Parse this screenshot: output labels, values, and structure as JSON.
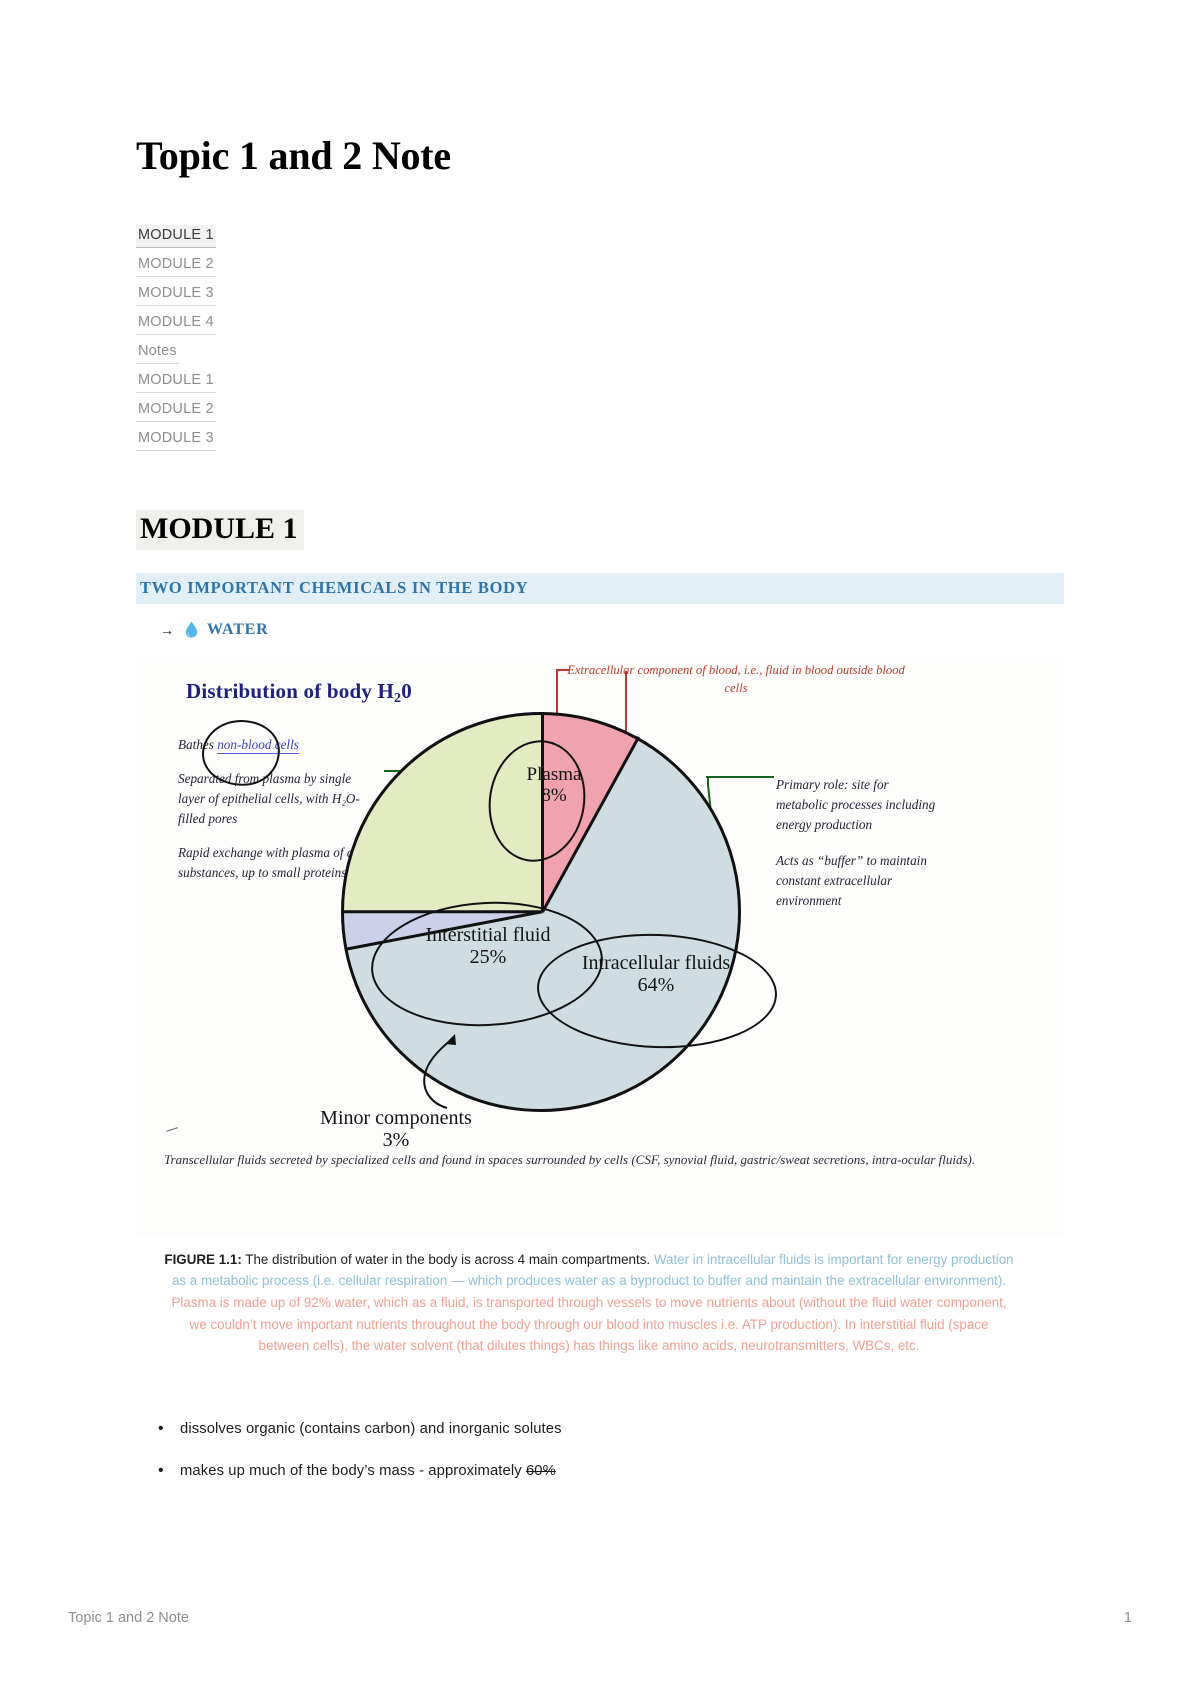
{
  "document": {
    "title": "Topic 1 and 2 Note",
    "footer_left": "Topic 1 and 2 Note",
    "footer_right": "1"
  },
  "toc": {
    "items": [
      {
        "label": "MODULE 1",
        "active": true
      },
      {
        "label": "MODULE 2",
        "active": false
      },
      {
        "label": "MODULE 3",
        "active": false
      },
      {
        "label": "MODULE 4",
        "active": false
      },
      {
        "label": "Notes",
        "active": false
      },
      {
        "label": "MODULE 1",
        "active": false
      },
      {
        "label": "MODULE 2",
        "active": false
      },
      {
        "label": "MODULE 3",
        "active": false
      }
    ]
  },
  "headings": {
    "module": "MODULE 1",
    "section": "TWO IMPORTANT CHEMICALS IN THE BODY",
    "module_highlight_color": "#efefec",
    "section_highlight_color": "#e3eff6",
    "section_text_color": "#2e74a8"
  },
  "water_item": {
    "arrow": "→",
    "icon": "water-droplet-icon",
    "label": "WATER",
    "color": "#2e74a8"
  },
  "figure": {
    "title_main": "Distribution of body H",
    "title_sub": "2",
    "title_tail": "0",
    "title_color": "#202080",
    "annotations": {
      "left_1_prefix": "Bathes ",
      "left_1_underlined": "non-blood cells",
      "left_2": "Separated from plasma by single layer of epithelial cells, with H₂O-filled pores",
      "left_3": "Rapid exchange with plasma of all substances, up to small proteins.",
      "top_right_red": "Extracellular component of blood, i.e., fluid in blood outside blood cells",
      "right_1": "Primary role: site for metabolic processes including energy production",
      "right_2": "Acts as “buffer” to maintain constant extracellular environment"
    },
    "footnote": "Transcellular fluids secreted by specialized cells and found in spaces surrounded by cells (CSF, synovial fluid, gastric/sweat secretions, intra-ocular fluids).",
    "caption": {
      "lead": "FIGURE 1.1:",
      "black_text": " The distribution of water in the body is across 4 main compartments. ",
      "blue_text": "Water in intracellular fluids is important for energy production as a metabolic process (i.e. cellular respiration — which produces water as a byproduct to buffer and maintain the extracellular environment). ",
      "salmon_text": "Plasma is made up of 92% water, which as a fluid, is transported through vessels to move nutrients about (without the fluid water component, we couldn’t move important nutrients throughout the body through our blood into muscles i.e. ATP production). In interstitial fluid (space between cells), the water solvent (that dilutes things) has things like amino acids, neurotransmitters, WBCs, etc.",
      "black_color": "#1f1f1f",
      "blue_color": "#8fc0d6",
      "salmon_color": "#ef9f92"
    }
  },
  "chart_data": {
    "type": "pie",
    "title": "Distribution of body H20",
    "categories": [
      "Plasma",
      "Intracellular fluids",
      "Minor components",
      "Interstitial fluid"
    ],
    "values": [
      8,
      64,
      3,
      25
    ],
    "labels": [
      {
        "name": "Plasma",
        "percent": "8%",
        "color": "#f0a3ae"
      },
      {
        "name": "Intracellular fluids",
        "percent": "64%",
        "color": "#cfdde2"
      },
      {
        "name": "Minor components",
        "percent": "3%",
        "color": "#ccd0ea"
      },
      {
        "name": "Interstitial fluid",
        "percent": "25%",
        "color": "#e2ebc2"
      }
    ],
    "units": "percent",
    "legend": "none",
    "grid": false
  },
  "bullets": {
    "items": [
      {
        "text": "dissolves organic (contains carbon) and inorganic solutes",
        "strike_tail": ""
      },
      {
        "text": "makes up much of the body’s mass - approximately ",
        "strike_tail": "60%"
      }
    ]
  }
}
